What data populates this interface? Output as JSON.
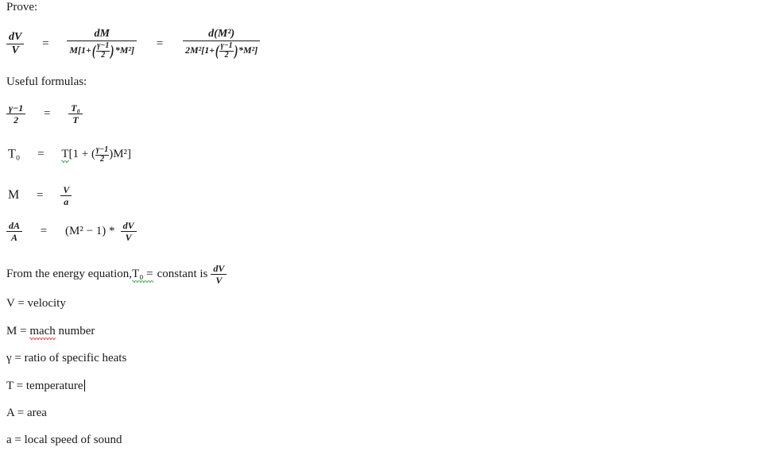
{
  "document": {
    "type": "word-processor-document",
    "background_color": "#ffffff",
    "text_color": "#1a1a1a",
    "spellcheck_red": "#e03131",
    "grammar_green": "#2f9e44"
  },
  "headings": {
    "prove": "Prove:",
    "useful_formulas": "Useful formulas:"
  },
  "symbols": {
    "equals": "=",
    "gamma": "γ",
    "minus": "−",
    "asterisk": "*",
    "plus": "+",
    "one": "1",
    "two": "2",
    "lbracket": "[",
    "rbracket": "]",
    "lparen": "(",
    "rparen": ")"
  },
  "main_equation": {
    "name": "prove-equation",
    "lhs": {
      "num": "dV",
      "den": "V"
    },
    "middle": {
      "num": "dM",
      "den_prefix": "M[1+",
      "den_frac_num": "γ−1",
      "den_frac_den": "2",
      "den_suffix": "*M²]"
    },
    "rhs": {
      "num": "d(M²)",
      "den_prefix": "2M²[1+",
      "den_frac_num": "γ−1",
      "den_frac_den": "2",
      "den_suffix": "*M²]"
    }
  },
  "formulas": [
    {
      "name": "gamma-ratio-temperature-ratio",
      "lhs_num": "γ−1",
      "lhs_den": "2",
      "rhs_num": "T₀",
      "rhs_den": "T"
    },
    {
      "name": "stagnation-temperature",
      "lhs": "T₀",
      "rhs_prefix": "T[1 + (",
      "rhs_frac_num": "γ−1",
      "rhs_frac_den": "2",
      "rhs_suffix": ")M²]",
      "misspelled_token": "T",
      "squiggle": "green"
    },
    {
      "name": "mach-number-definition",
      "lhs": "M",
      "rhs_num": "V",
      "rhs_den": "a"
    },
    {
      "name": "area-velocity-relation",
      "lhs_num": "dA",
      "lhs_den": "A",
      "rhs_text": "(M² − 1) *",
      "rhs_num": "dV",
      "rhs_den": "V"
    }
  ],
  "energy_statement": {
    "name": "energy-equation-statement",
    "part1": "From the energy equation,",
    "flagged": " T₀ =",
    "part2": "constant is",
    "trailing_num": "dV",
    "trailing_den": "V",
    "squiggle": "green"
  },
  "definitions": [
    {
      "symbol": "V",
      "equals": "=",
      "text": "velocity",
      "misspelled": "",
      "misspelled_word": "",
      "has_caret": false
    },
    {
      "symbol": "M",
      "equals": "=",
      "text": " number",
      "misspelled_word": "mach",
      "has_caret": false
    },
    {
      "symbol": "γ",
      "equals": "=",
      "text": "ratio of specific heats",
      "misspelled_word": "",
      "has_caret": false
    },
    {
      "symbol": "T",
      "equals": "=",
      "text": "temperature",
      "misspelled_word": "",
      "has_caret": true
    },
    {
      "symbol": "A",
      "equals": "=",
      "text": "area",
      "misspelled_word": "",
      "has_caret": false
    },
    {
      "symbol": "a",
      "equals": "=",
      "text": "local speed of sound",
      "misspelled_word": "",
      "has_caret": false
    }
  ]
}
